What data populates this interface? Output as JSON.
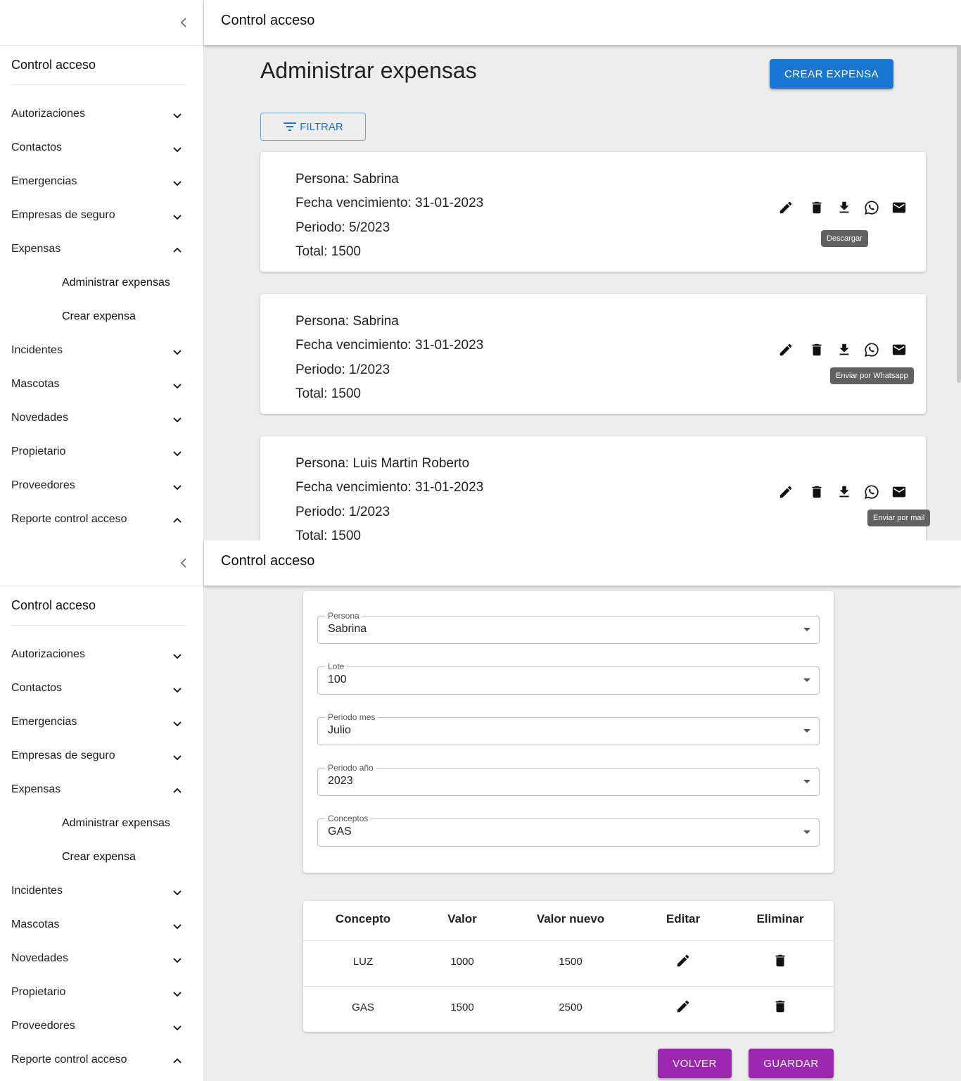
{
  "app_title": "Control acceso",
  "sidebar": {
    "title": "Control acceso",
    "items": [
      {
        "label": "Autorizaciones",
        "expanded": false
      },
      {
        "label": "Contactos",
        "expanded": false
      },
      {
        "label": "Emergencias",
        "expanded": false
      },
      {
        "label": "Empresas de seguro",
        "expanded": false
      },
      {
        "label": "Expensas",
        "expanded": true
      },
      {
        "label": "Incidentes",
        "expanded": false
      },
      {
        "label": "Mascotas",
        "expanded": false
      },
      {
        "label": "Novedades",
        "expanded": false
      },
      {
        "label": "Propietario",
        "expanded": false
      },
      {
        "label": "Proveedores",
        "expanded": false
      },
      {
        "label": "Reporte control acceso",
        "expanded": true
      }
    ],
    "expensas_sub": [
      "Administrar expensas",
      "Crear expensa"
    ]
  },
  "list_page": {
    "title": "Administrar expensas",
    "create_button": "CREAR EXPENSA",
    "filter_button": "FILTRAR",
    "expensas": [
      {
        "persona": "Persona: Sabrina",
        "fecha": "Fecha vencimiento: 31-01-2023",
        "periodo": "Periodo: 5/2023",
        "total": "Total: 1500",
        "tooltip": "Descargar"
      },
      {
        "persona": "Persona: Sabrina",
        "fecha": "Fecha vencimiento: 31-01-2023",
        "periodo": "Periodo: 1/2023",
        "total": "Total: 1500",
        "tooltip": "Enviar por Whatsapp"
      },
      {
        "persona": "Persona: Luis Martin Roberto",
        "fecha": "Fecha vencimiento: 31-01-2023",
        "periodo": "Periodo: 1/2023",
        "total": "Total: 1500",
        "tooltip": "Enviar por mail"
      }
    ]
  },
  "form_page": {
    "fields": [
      {
        "label": "Persona",
        "value": "Sabrina"
      },
      {
        "label": "Lote",
        "value": "100"
      },
      {
        "label": "Periodo mes",
        "value": "Julio"
      },
      {
        "label": "Periodo año",
        "value": "2023"
      },
      {
        "label": "Conceptos",
        "value": "GAS"
      }
    ],
    "table": {
      "headers": [
        "Concepto",
        "Valor",
        "Valor nuevo",
        "Editar",
        "Eliminar"
      ],
      "rows": [
        {
          "concepto": "LUZ",
          "valor": "1000",
          "valor_nuevo": "1500"
        },
        {
          "concepto": "GAS",
          "valor": "1500",
          "valor_nuevo": "2500"
        }
      ]
    },
    "back_button": "VOLVER",
    "save_button": "GUARDAR"
  },
  "colors": {
    "primary": "#1976d2",
    "secondary": "#9c27b0",
    "tooltip": "#616161"
  }
}
